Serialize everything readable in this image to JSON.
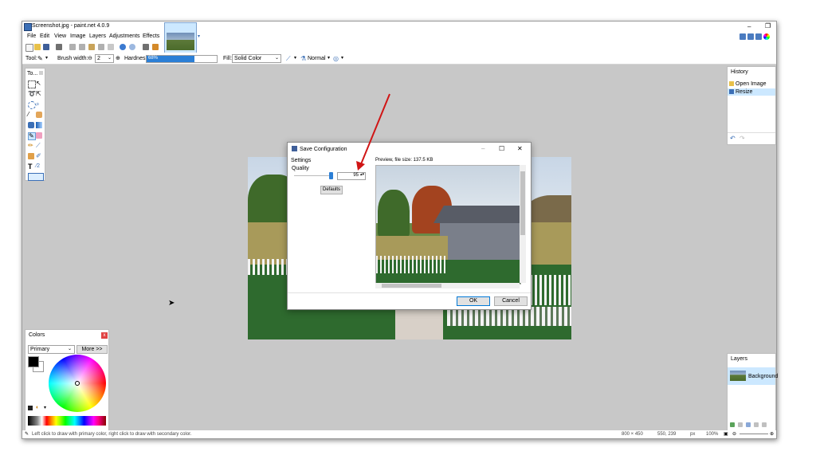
{
  "window": {
    "title": "Screenshot.jpg - paint.net 4.0.9"
  },
  "menu": [
    "File",
    "Edit",
    "View",
    "Image",
    "Layers",
    "Adjustments",
    "Effects"
  ],
  "tooloptions": {
    "tool_label": "Tool:",
    "brush_width_label": "Brush width:",
    "brush_width_value": "2",
    "hardness_label": "Hardness:",
    "hardness_value": "68%",
    "hardness_fraction": 0.68,
    "fill_label": "Fill:",
    "fill_value": "Solid Color",
    "blend_value": "Normal"
  },
  "tools_panel": {
    "title": "To..."
  },
  "history": {
    "title": "History",
    "items": [
      "Open Image",
      "Resize"
    ]
  },
  "colors": {
    "title": "Colors",
    "mode": "Primary",
    "more_button": "More >>",
    "close": "x"
  },
  "layers": {
    "title": "Layers",
    "items": [
      "Background"
    ]
  },
  "dialog": {
    "title": "Save Configuration",
    "settings_label": "Settings",
    "quality_label": "Quality",
    "quality_value": "95",
    "quality_fraction": 0.95,
    "defaults_button": "Defaults",
    "preview_label": "Preview, file size: 137.5 KB",
    "ok_button": "OK",
    "cancel_button": "Cancel"
  },
  "status": {
    "hint": "Left click to draw with primary color, right click to draw with secondary color.",
    "size": "800 × 450",
    "pos": "550, 239",
    "unit": "px",
    "zoom": "100%"
  },
  "colors_accent": {
    "selection": "#cce8ff",
    "arrow": "#d01515",
    "hardness": "#2b7fd6"
  }
}
